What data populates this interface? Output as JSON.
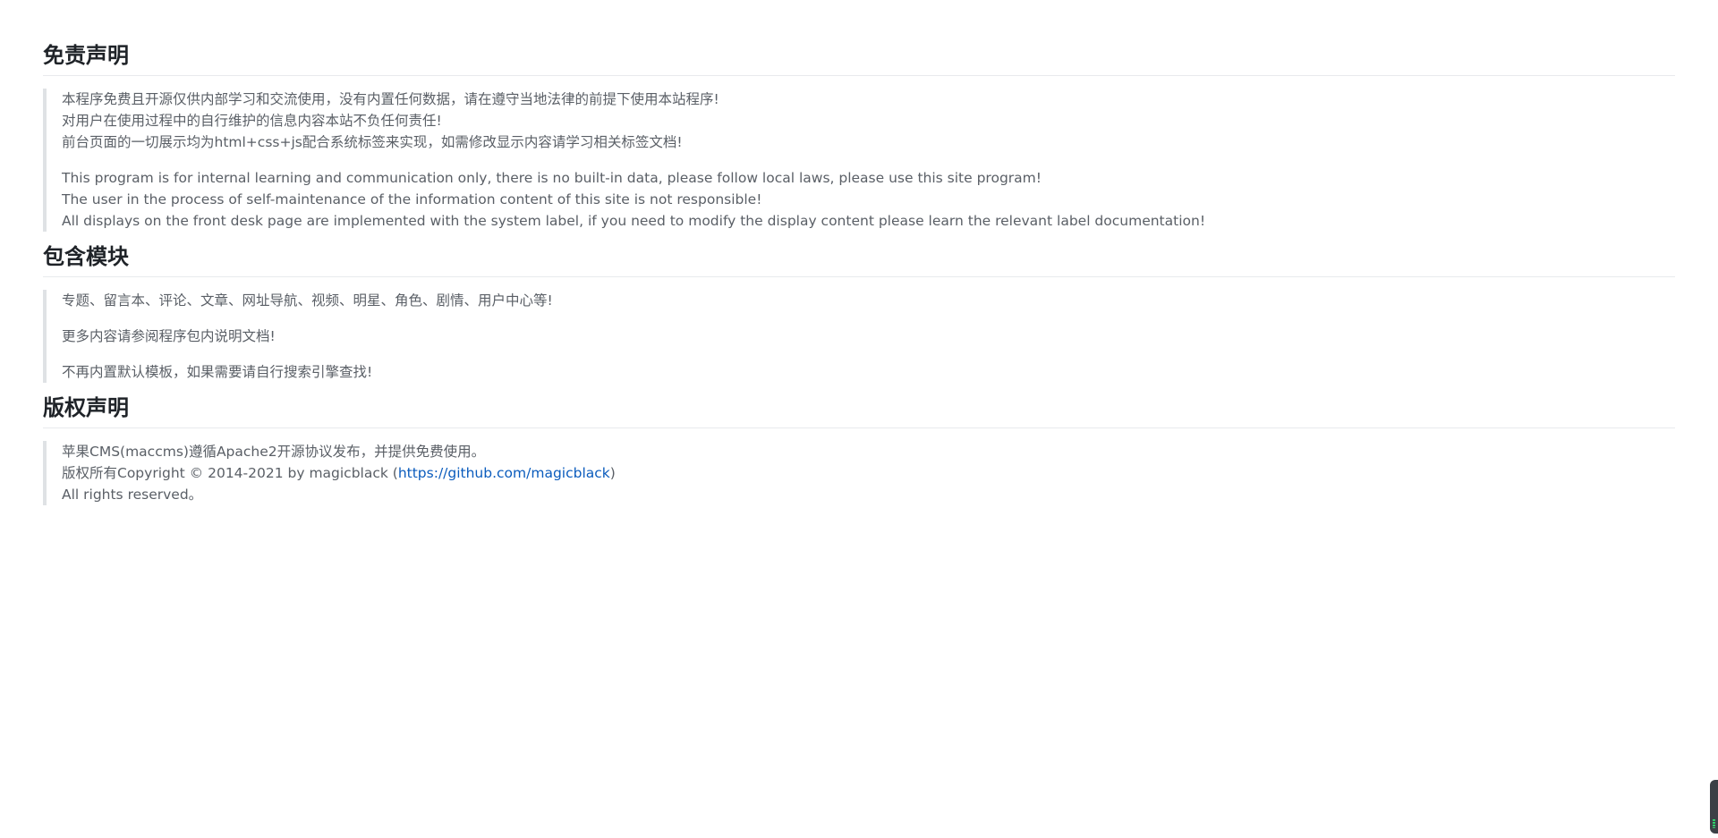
{
  "sections": [
    {
      "title": "免责声明",
      "paragraphs": [
        [
          "本程序免费且开源仅供内部学习和交流使用，没有内置任何数据，请在遵守当地法律的前提下使用本站程序!",
          "对用户在使用过程中的自行维护的信息内容本站不负任何责任!",
          "前台页面的一切展示均为html+css+js配合系统标签来实现，如需修改显示内容请学习相关标签文档!"
        ],
        [
          "This program is for internal learning and communication only, there is no built-in data, please follow local laws, please use this site program!",
          "The user in the process of self-maintenance of the information content of this site is not responsible!",
          "All displays on the front desk page are implemented with the system label, if you need to modify the display content please learn the relevant label documentation!"
        ]
      ]
    },
    {
      "title": "包含模块",
      "paragraphs": [
        [
          "专题、留言本、评论、文章、网址导航、视频、明星、角色、剧情、用户中心等!"
        ],
        [
          "更多内容请参阅程序包内说明文档!"
        ],
        [
          "不再内置默认模板，如果需要请自行搜索引擎查找!"
        ]
      ]
    },
    {
      "title": "版权声明",
      "lines": {
        "line1": "苹果CMS(maccms)遵循Apache2开源协议发布，并提供免费使用。",
        "line2_prefix": "版权所有Copyright © 2014-2021 by magicblack (",
        "line2_link": "https://github.com/magicblack",
        "line2_suffix": ")",
        "line3": "All rights reserved。"
      }
    }
  ],
  "colors": {
    "heading": "#1f2328",
    "body": "#5a5f66",
    "link": "#0b5cbd",
    "quote_border": "#dfe2e5"
  }
}
